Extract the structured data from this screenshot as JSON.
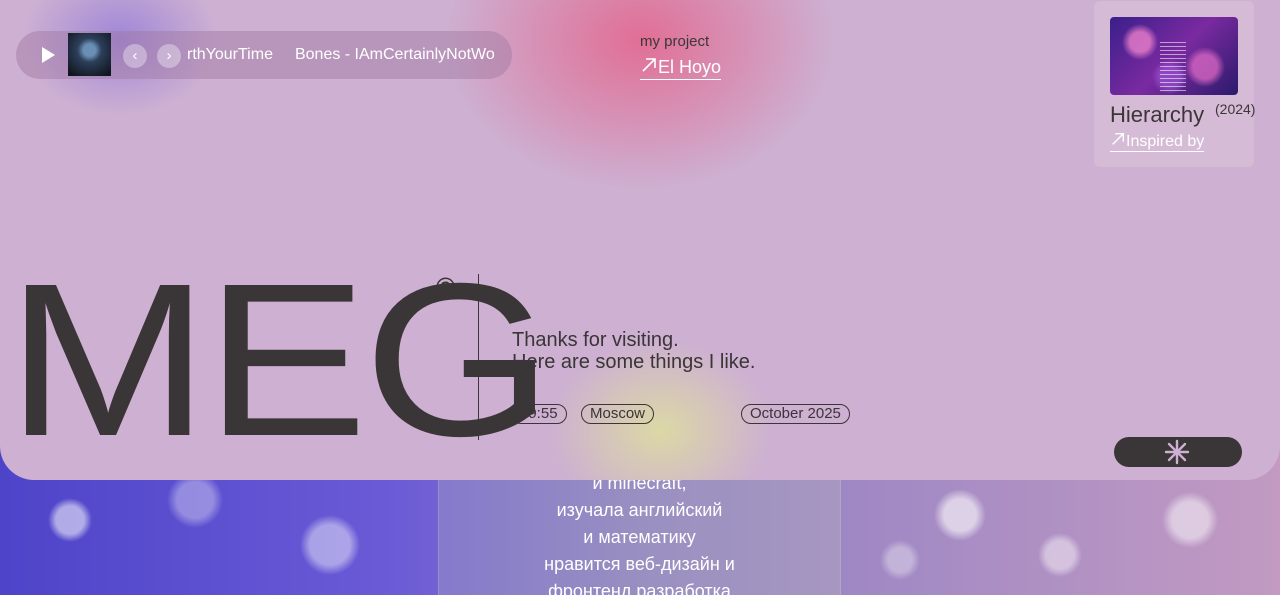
{
  "player": {
    "track_text": "rthYourTime",
    "track_next": "Bones - IAmCertainlyNotWo",
    "prev_glyph": "‹",
    "next_glyph": "›",
    "icons": [
      "play-icon",
      "album-cover",
      "chevron-left-icon",
      "chevron-right-icon"
    ]
  },
  "project": {
    "label": "my project",
    "link": "El Hoyo"
  },
  "feature": {
    "title": "Hierarchy",
    "year": "(2024)",
    "link": "Inspired by"
  },
  "hero": {
    "name": "MEG",
    "copyright": "©",
    "thanks_line1": "Thanks for visiting.",
    "thanks_line2": "Here are some things I like."
  },
  "tags": {
    "time": "09:55",
    "city": "Moscow",
    "date": "October 2025"
  },
  "bottom": {
    "lines": [
      "и minecraft,",
      "изучала английский",
      "и математику",
      "нравится веб-дизайн и",
      "фронтенд разработка"
    ]
  },
  "colors": {
    "card": "#cdb0d2",
    "text_dark": "#3a3536",
    "accent_pink": "#e85880",
    "accent_yellow": "#e1e696"
  }
}
